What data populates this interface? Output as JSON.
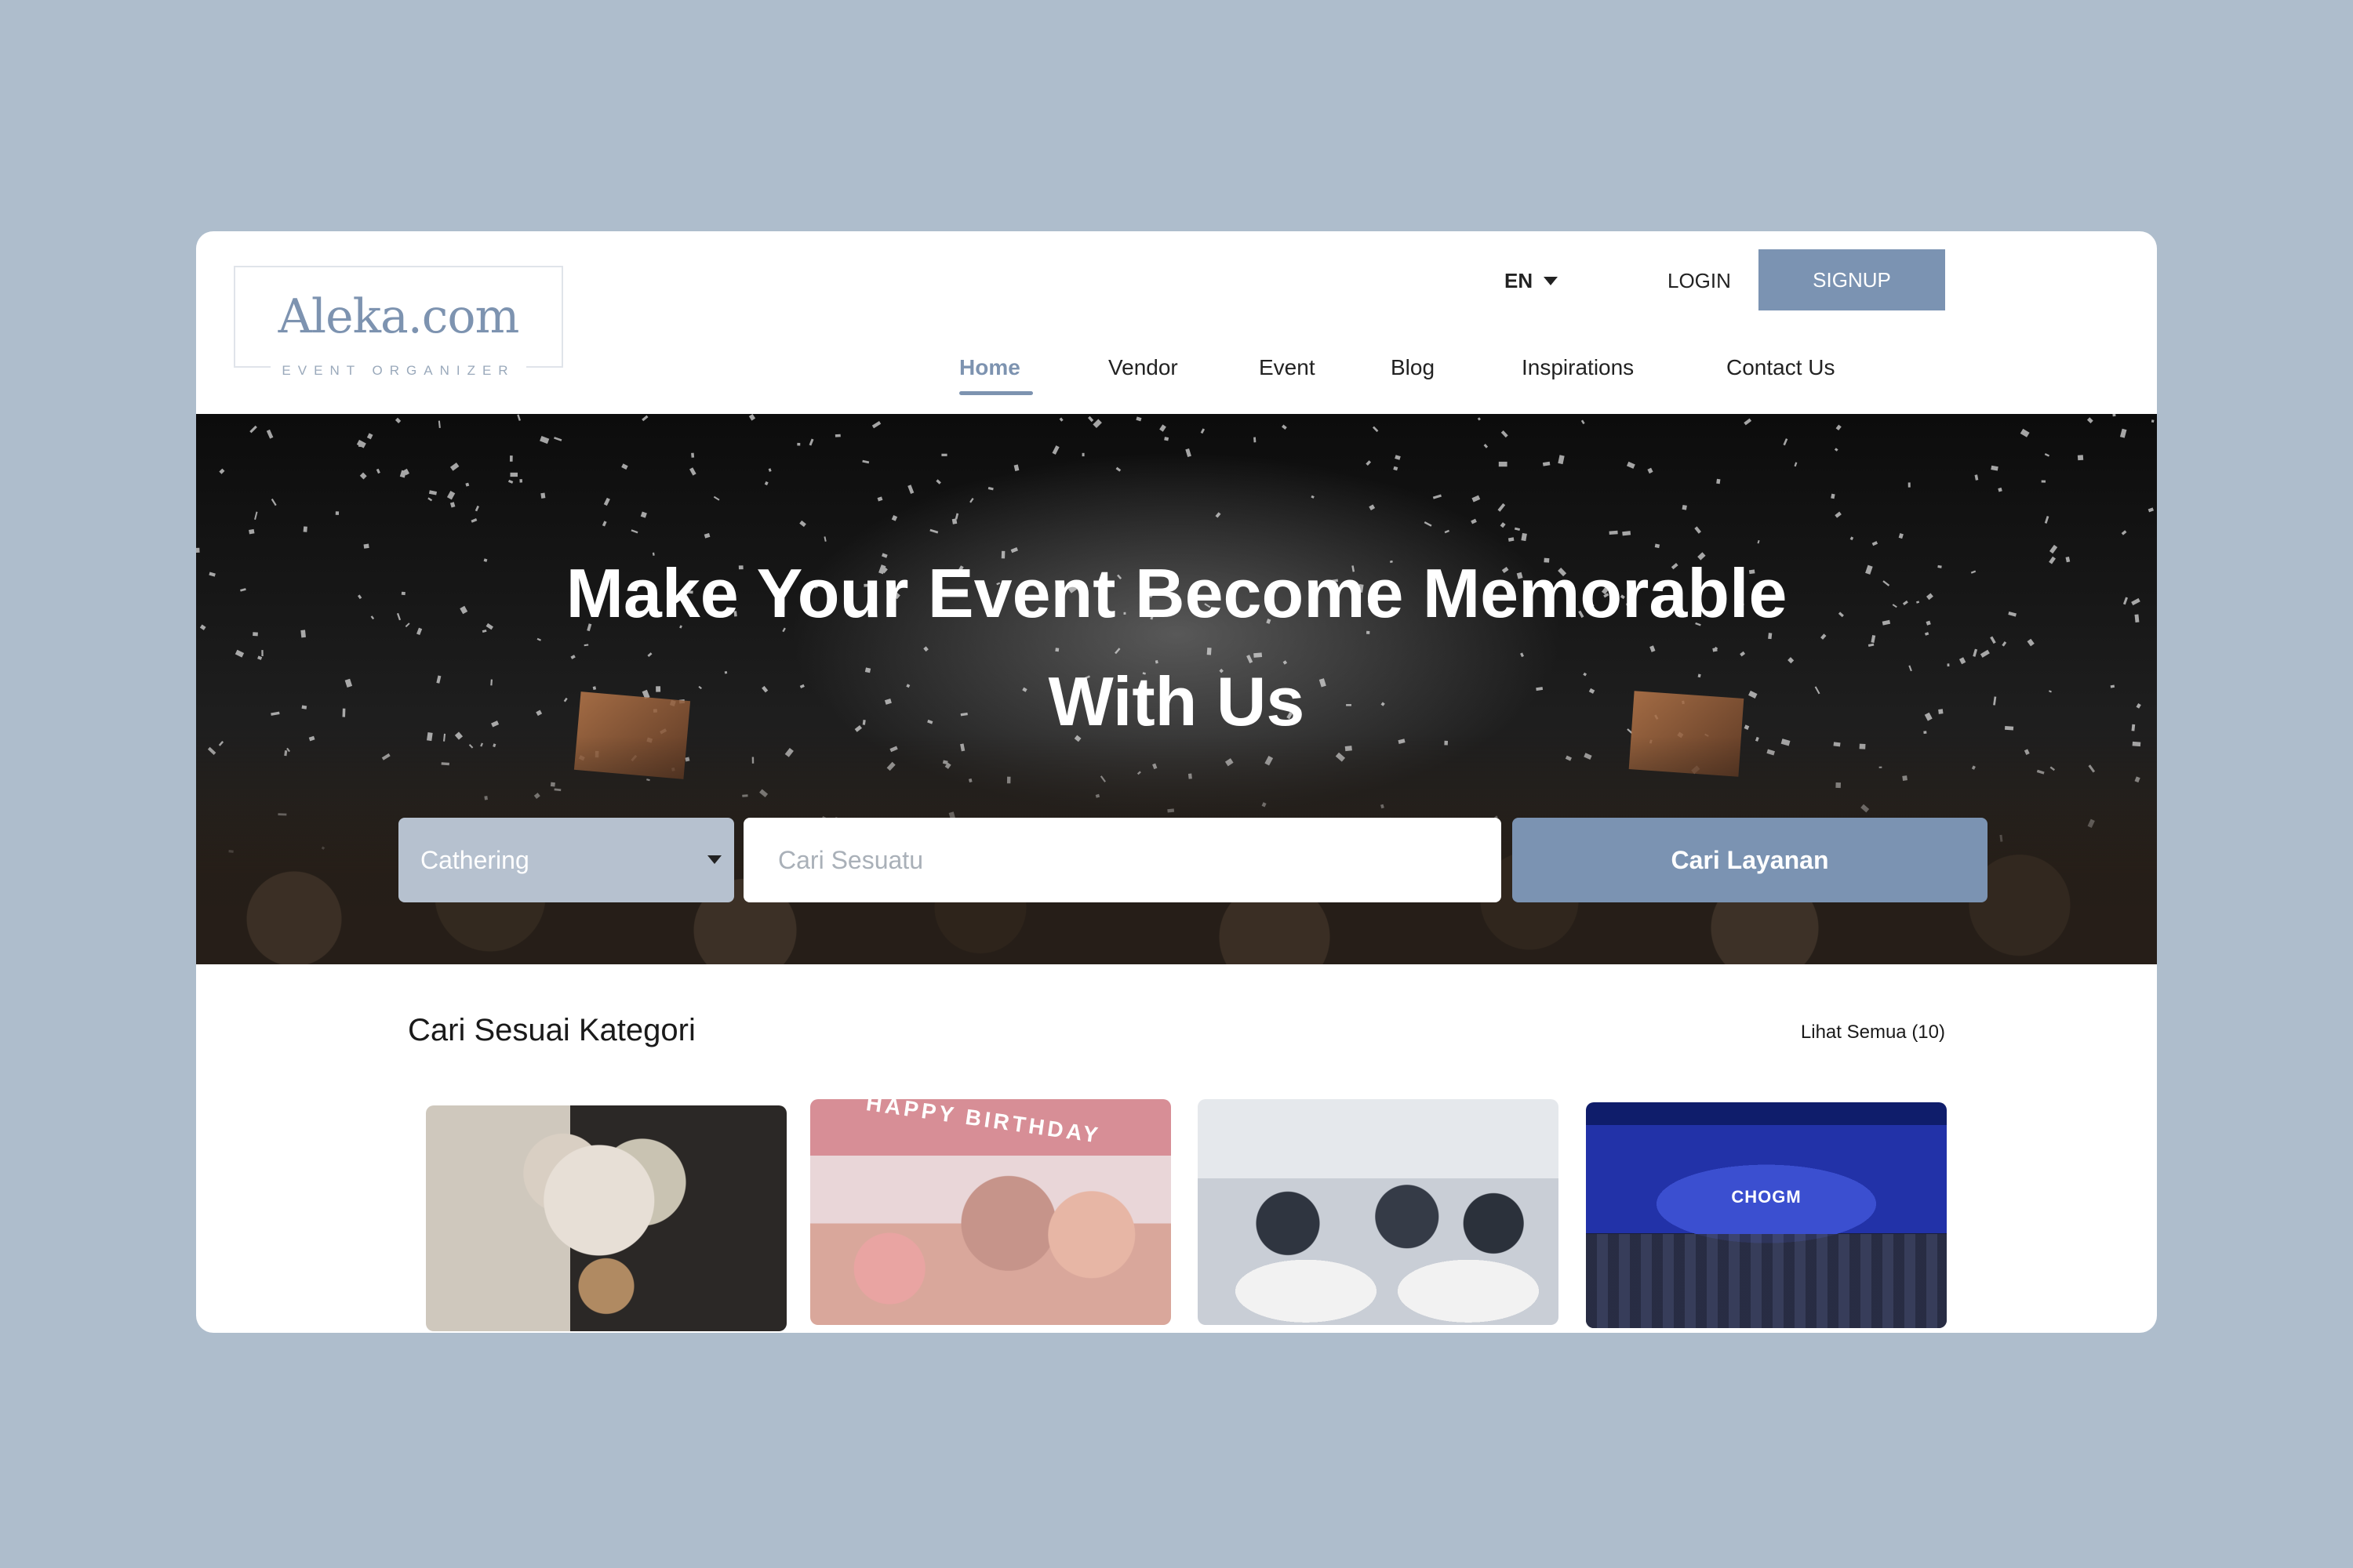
{
  "logo": {
    "name": "Aleka.com",
    "tagline": "EVENT ORGANIZER"
  },
  "header": {
    "language": "EN",
    "login_label": "LOGIN",
    "signup_label": "SIGNUP"
  },
  "nav": {
    "items": [
      {
        "label": "Home",
        "active": true
      },
      {
        "label": "Vendor"
      },
      {
        "label": "Event"
      },
      {
        "label": "Blog"
      },
      {
        "label": "Inspirations"
      },
      {
        "label": "Contact Us"
      }
    ]
  },
  "hero": {
    "title_line1": "Make Your Event Become Memorable",
    "title_line2": "With Us",
    "category_selected": "Cathering",
    "search_placeholder": "Cari Sesuatu",
    "search_button": "Cari Layanan"
  },
  "categories": {
    "title": "Cari Sesuai Kategori",
    "see_all": "Lihat Semua (10)",
    "cards": [
      {
        "image": "wedding-bouquet-photo"
      },
      {
        "image": "birthday-party-photo",
        "banner_text": "HAPPY BIRTHDAY"
      },
      {
        "image": "business-gathering-photo"
      },
      {
        "image": "conference-photo",
        "stage_text": "CHOGM"
      }
    ]
  },
  "colors": {
    "background": "#aebdcc",
    "accent": "#7b93b2",
    "select_bg": "#b6c1cf",
    "logo": "#7d93b0"
  }
}
